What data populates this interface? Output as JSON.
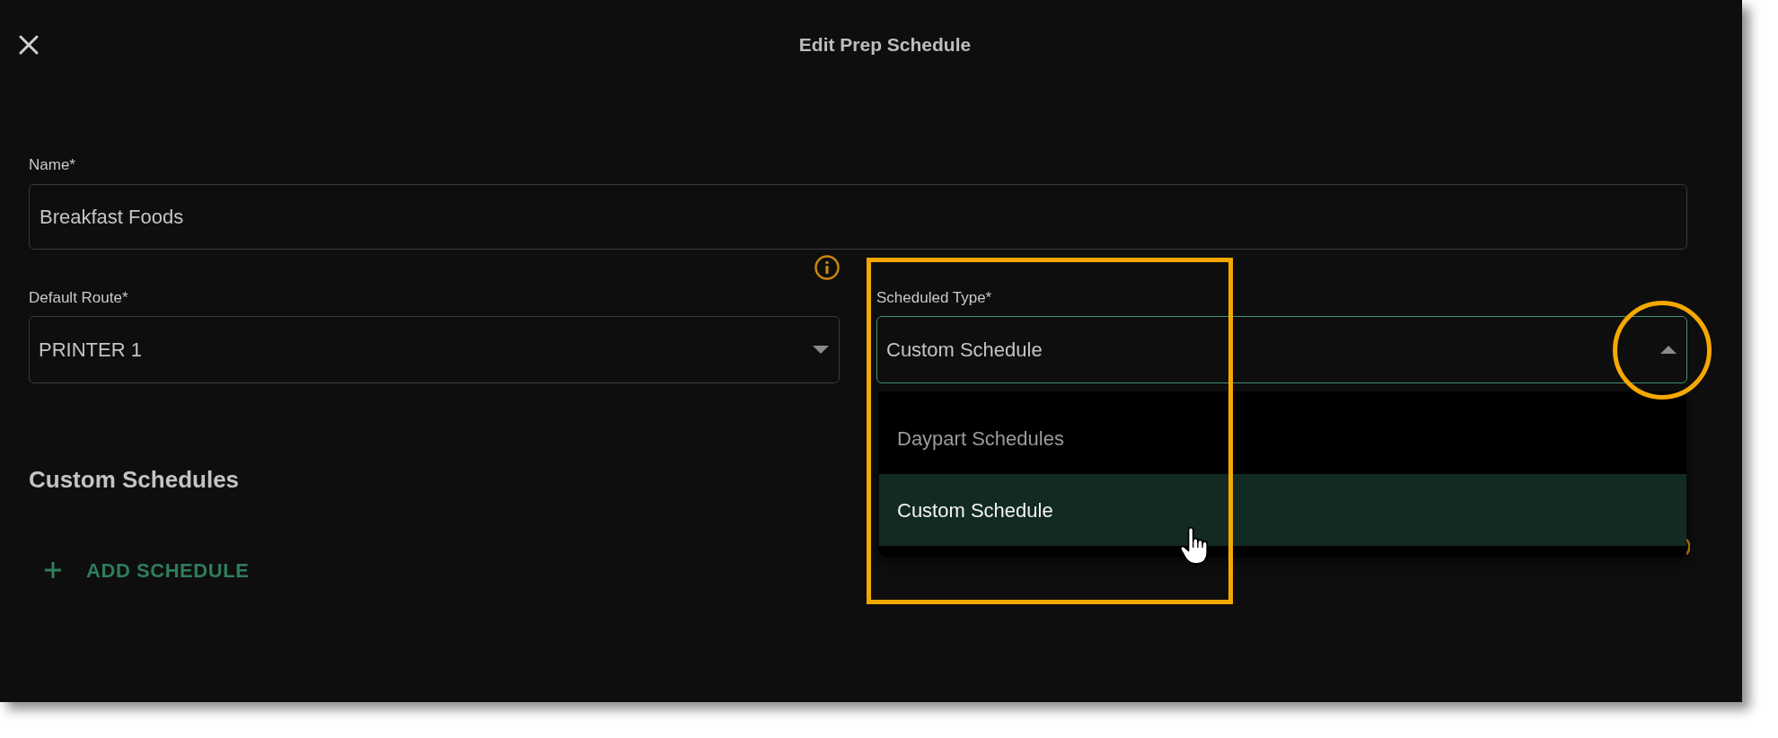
{
  "dialog": {
    "title": "Edit Prep Schedule"
  },
  "name_field": {
    "label": "Name*",
    "value": "Breakfast Foods"
  },
  "selects": [
    {
      "label": "Default Route*",
      "value": "PRINTER 1",
      "expanded": false
    },
    {
      "label": "Scheduled Type*",
      "value": "Custom Schedule",
      "expanded": true,
      "options": [
        {
          "label": "Daypart Schedules",
          "selected": false
        },
        {
          "label": "Custom Schedule",
          "selected": true
        }
      ]
    }
  ],
  "custom_schedules": {
    "heading": "Custom Schedules",
    "add_button": "ADD SCHEDULE"
  }
}
